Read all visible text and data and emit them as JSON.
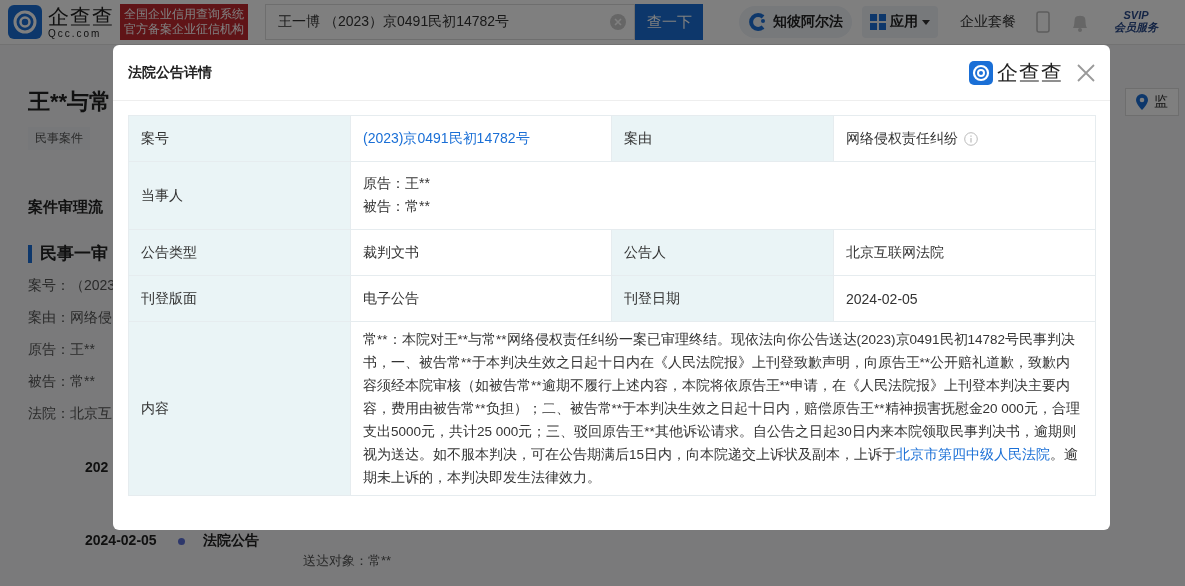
{
  "header": {
    "logo_name": "企查查",
    "logo_domain": "Qcc.com",
    "badge_lines": [
      "全国企业信用查询系统",
      "官方备案企业征信机构"
    ],
    "search": {
      "value": "王一博 （2023）京0491民初14782号"
    },
    "search_button": "查一下",
    "alpha_link": "知彼阿尔法",
    "apps_menu": "应用",
    "package_link": "企业套餐",
    "svip_title": "SVIP",
    "svip_sub": "会员服务"
  },
  "page": {
    "title": "王**与常",
    "tags": [
      "民事案件"
    ],
    "section_title": "案件审理流",
    "stage_title": "民事一审",
    "fields": [
      {
        "label": "案号：",
        "value": "（2023"
      },
      {
        "label": "案由：",
        "value": "网络侵"
      },
      {
        "label": "原告：",
        "value": "王**"
      },
      {
        "label": "被告：",
        "value": "常**"
      },
      {
        "label": "法院：",
        "value": "北京互"
      }
    ],
    "timeline": [
      {
        "date": "202"
      },
      {
        "date": "2024-02-05",
        "type": "法院公告",
        "detail": "送达对象：常**"
      }
    ],
    "monitor_button": "监"
  },
  "modal": {
    "title": "法院公告详情",
    "brand": "企查查",
    "rows": [
      {
        "cells": [
          {
            "label": "案号",
            "lines": [
              "(2023)京0491民初14782号"
            ],
            "link": true
          },
          {
            "label": "案由",
            "lines": [
              "网络侵权责任纠纷"
            ],
            "link": false,
            "info": true
          }
        ]
      },
      {
        "cells": [
          {
            "label": "当事人",
            "lines": [
              "原告：王**",
              "被告：常**"
            ],
            "link": false
          }
        ]
      },
      {
        "cells": [
          {
            "label": "公告类型",
            "lines": [
              "裁判文书"
            ],
            "link": false
          },
          {
            "label": "公告人",
            "lines": [
              "北京互联网法院"
            ],
            "link": false
          }
        ]
      },
      {
        "cells": [
          {
            "label": "刊登版面",
            "lines": [
              "电子公告"
            ],
            "link": false
          },
          {
            "label": "刊登日期",
            "lines": [
              "2024-02-05"
            ],
            "link": false
          }
        ]
      }
    ],
    "content": {
      "label": "内容",
      "before": "常**：本院对王**与常**网络侵权责任纠纷一案已审理终结。现依法向你公告送达(2023)京0491民初14782号民事判决书，一、被告常**于本判决生效之日起十日内在《人民法院报》上刊登致歉声明，向原告王**公开赔礼道歉，致歉内容须经本院审核（如被告常**逾期不履行上述内容，本院将依原告王**申请，在《人民法院报》上刊登本判决主要内容，费用由被告常**负担）；二、被告常**于本判决生效之日起十日内，赔偿原告王**精神损害抚慰金20 000元，合理支出5000元，共计25 000元；三、驳回原告王**其他诉讼请求。自公告之日起30日内来本院领取民事判决书，逾期则视为送达。如不服本判决，可在公告期满后15日内，向本院递交上诉状及副本，上诉于",
      "link": "北京市第四中级人民法院",
      "after": "。逾期未上诉的，本判决即发生法律效力。"
    }
  }
}
